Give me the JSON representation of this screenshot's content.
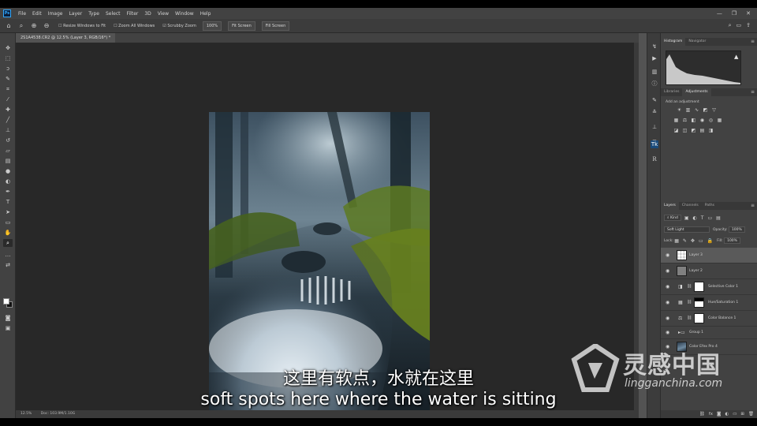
{
  "menubar": {
    "logo": "Ps",
    "items": [
      "File",
      "Edit",
      "Image",
      "Layer",
      "Type",
      "Select",
      "Filter",
      "3D",
      "View",
      "Window",
      "Help"
    ],
    "window_controls": [
      "—",
      "❐",
      "✕"
    ]
  },
  "options_bar": {
    "resize_windows": "Resize Windows to Fit",
    "zoom_all_windows": "Zoom All Windows",
    "scrubby_zoom": "Scrubby Zoom",
    "zoom_level": "100%",
    "fit_screen": "Fit Screen",
    "fill_screen": "Fill Screen"
  },
  "document": {
    "tab_title": "2S1A4538.CR2 @ 12.5% (Layer 3, RGB/16*) *"
  },
  "histogram_panel": {
    "tabs": [
      "Histogram",
      "Navigator"
    ]
  },
  "adjustments_panel": {
    "tabs": [
      "Libraries",
      "Adjustments"
    ],
    "add_label": "Add an adjustment"
  },
  "layers_panel": {
    "tabs": [
      "Layers",
      "Channels",
      "Paths"
    ],
    "filter_kind": "Kind",
    "blend_mode": "Soft Light",
    "opacity_label": "Opacity:",
    "opacity_value": "100%",
    "lock_label": "Lock:",
    "fill_label": "Fill:",
    "fill_value": "100%",
    "layers": [
      {
        "name": "Layer 3"
      },
      {
        "name": "Layer 2"
      },
      {
        "name": "Selective Color 1"
      },
      {
        "name": "Hue/Saturation 1"
      },
      {
        "name": "Color Balance 1"
      },
      {
        "name": "Group 1"
      },
      {
        "name": "Color Efex Pro 4"
      }
    ]
  },
  "statusbar": {
    "zoom": "12.5%",
    "doc_info": "Doc: 103.9M/1.10G"
  },
  "subtitles": {
    "chinese": "这里有软点，水就在这里",
    "english": "soft spots here where the water is sitting"
  },
  "watermark": {
    "brand_cn": "灵感中国",
    "url": "lingganchina.com"
  }
}
